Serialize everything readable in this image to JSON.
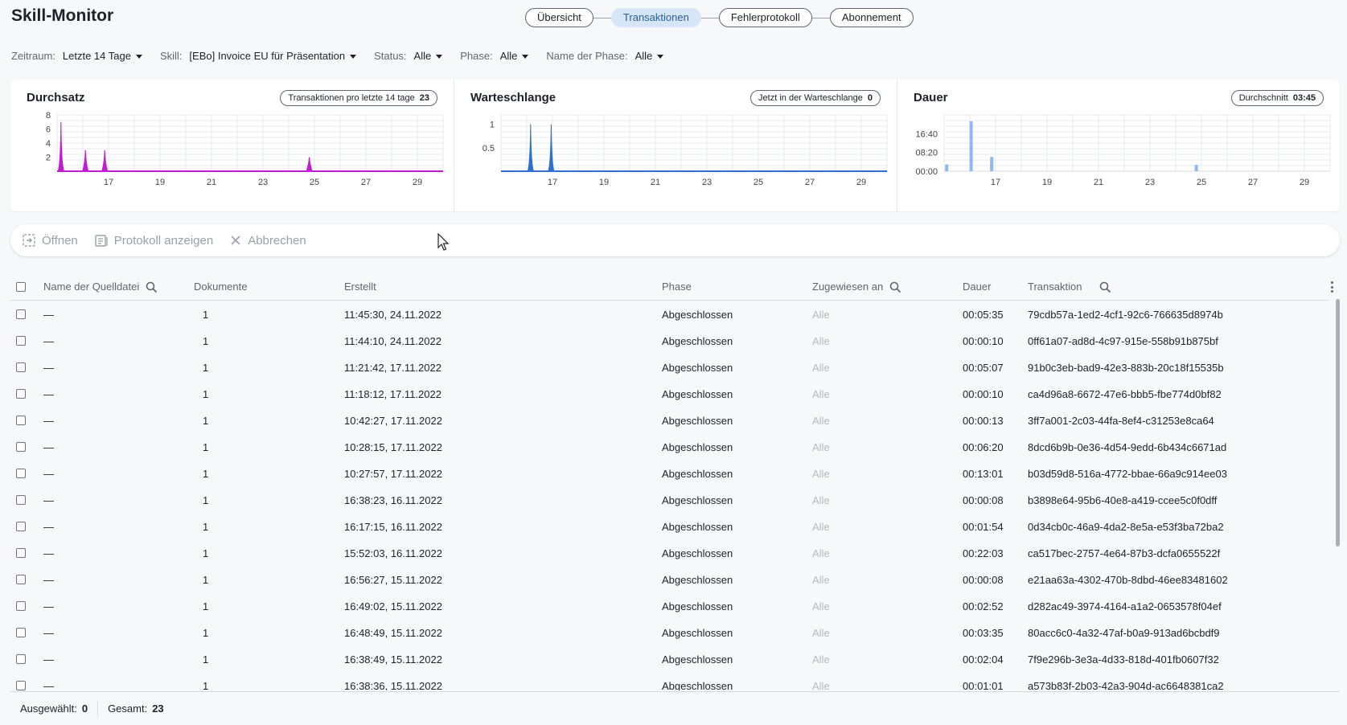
{
  "app": {
    "title": "Skill-Monitor"
  },
  "tabs": [
    {
      "label": "Übersicht",
      "active": false
    },
    {
      "label": "Transaktionen",
      "active": true
    },
    {
      "label": "Fehlerprotokoll",
      "active": false
    },
    {
      "label": "Abonnement",
      "active": false
    }
  ],
  "filters": {
    "period": {
      "label": "Zeitraum:",
      "value": "Letzte 14 Tage"
    },
    "skill": {
      "label": "Skill:",
      "value": "[EBo] Invoice EU für Präsentation"
    },
    "status": {
      "label": "Status:",
      "value": "Alle"
    },
    "phase": {
      "label": "Phase:",
      "value": "Alle"
    },
    "phase_name": {
      "label": "Name der Phase:",
      "value": "Alle"
    }
  },
  "cards": {
    "throughput": {
      "title": "Durchsatz",
      "badge_label": "Transaktionen pro letzte 14 tage",
      "badge_value": "23"
    },
    "queue": {
      "title": "Warteschlange",
      "badge_label": "Jetzt in der Warteschlange",
      "badge_value": "0"
    },
    "duration": {
      "title": "Dauer",
      "badge_label": "Durchschnitt",
      "badge_value": "03:45"
    }
  },
  "chart_data": [
    {
      "type": "area",
      "title": "Durchsatz",
      "x_ticks": [
        "17",
        "19",
        "21",
        "23",
        "25",
        "27",
        "29"
      ],
      "y_ticks": [
        "2",
        "4",
        "6",
        "8"
      ],
      "ylim": [
        0,
        8
      ],
      "xlim": [
        15,
        30
      ],
      "color": "#c21bd1",
      "grid": true,
      "points": [
        {
          "x": 15.15,
          "y": 7
        },
        {
          "x": 16.1,
          "y": 3
        },
        {
          "x": 16.85,
          "y": 3
        },
        {
          "x": 24.8,
          "y": 2
        }
      ]
    },
    {
      "type": "area",
      "title": "Warteschlange",
      "x_ticks": [
        "17",
        "19",
        "21",
        "23",
        "25",
        "27",
        "29"
      ],
      "y_ticks": [
        "0.5",
        "1"
      ],
      "ylim": [
        0,
        1.2
      ],
      "xlim": [
        15,
        30
      ],
      "color": "#2e6fcf",
      "grid": true,
      "points": [
        {
          "x": 16.15,
          "y": 1
        },
        {
          "x": 16.95,
          "y": 1
        }
      ]
    },
    {
      "type": "bar",
      "title": "Dauer",
      "x_ticks": [
        "17",
        "19",
        "21",
        "23",
        "25",
        "27",
        "29"
      ],
      "y_ticks": [
        "00:00",
        "08:20",
        "16:40"
      ],
      "ylim": [
        0,
        1500
      ],
      "xlim": [
        15,
        30
      ],
      "color": "#8fb8ec",
      "grid": true,
      "points": [
        {
          "x": 15.1,
          "y": 180
        },
        {
          "x": 16.05,
          "y": 1330
        },
        {
          "x": 16.85,
          "y": 380
        },
        {
          "x": 24.8,
          "y": 170
        }
      ]
    }
  ],
  "toolbar": {
    "open": "Öffnen",
    "show_log": "Protokoll anzeigen",
    "cancel": "Abbrechen"
  },
  "table": {
    "columns": {
      "source": "Name der Quelldatei",
      "documents": "Dokumente",
      "created": "Erstellt",
      "phase": "Phase",
      "assigned": "Zugewiesen an",
      "duration": "Dauer",
      "transaction": "Transaktion"
    },
    "rows": [
      {
        "source": "—",
        "documents": "1",
        "created": "11:45:30, 24.11.2022",
        "phase": "Abgeschlossen",
        "assigned": "Alle",
        "duration": "00:05:35",
        "transaction": "79cdb57a-1ed2-4cf1-92c6-766635d8974b"
      },
      {
        "source": "—",
        "documents": "1",
        "created": "11:44:10, 24.11.2022",
        "phase": "Abgeschlossen",
        "assigned": "Alle",
        "duration": "00:00:10",
        "transaction": "0ff61a07-ad8d-4c97-915e-558b91b875bf"
      },
      {
        "source": "—",
        "documents": "1",
        "created": "11:21:42, 17.11.2022",
        "phase": "Abgeschlossen",
        "assigned": "Alle",
        "duration": "00:05:07",
        "transaction": "91b0c3eb-bad9-42e3-883b-20c18f15535b"
      },
      {
        "source": "—",
        "documents": "1",
        "created": "11:18:12, 17.11.2022",
        "phase": "Abgeschlossen",
        "assigned": "Alle",
        "duration": "00:00:10",
        "transaction": "ca4d96a8-6672-47e6-bbb5-fbe774d0bf82"
      },
      {
        "source": "—",
        "documents": "1",
        "created": "10:42:27, 17.11.2022",
        "phase": "Abgeschlossen",
        "assigned": "Alle",
        "duration": "00:00:13",
        "transaction": "3ff7a001-2c03-44fa-8ef4-c31253e8ca64"
      },
      {
        "source": "—",
        "documents": "1",
        "created": "10:28:15, 17.11.2022",
        "phase": "Abgeschlossen",
        "assigned": "Alle",
        "duration": "00:06:20",
        "transaction": "8dcd6b9b-0e36-4d54-9edd-6b434c6671ad"
      },
      {
        "source": "—",
        "documents": "1",
        "created": "10:27:57, 17.11.2022",
        "phase": "Abgeschlossen",
        "assigned": "Alle",
        "duration": "00:13:01",
        "transaction": "b03d59d8-516a-4772-bbae-66a9c914ee03"
      },
      {
        "source": "—",
        "documents": "1",
        "created": "16:38:23, 16.11.2022",
        "phase": "Abgeschlossen",
        "assigned": "Alle",
        "duration": "00:00:08",
        "transaction": "b3898e64-95b6-40e8-a419-ccee5c0f0dff"
      },
      {
        "source": "—",
        "documents": "1",
        "created": "16:17:15, 16.11.2022",
        "phase": "Abgeschlossen",
        "assigned": "Alle",
        "duration": "00:01:54",
        "transaction": "0d34cb0c-46a9-4da2-8e5a-e53f3ba72ba2"
      },
      {
        "source": "—",
        "documents": "1",
        "created": "15:52:03, 16.11.2022",
        "phase": "Abgeschlossen",
        "assigned": "Alle",
        "duration": "00:22:03",
        "transaction": "ca517bec-2757-4e64-87b3-dcfa0655522f"
      },
      {
        "source": "—",
        "documents": "1",
        "created": "16:56:27, 15.11.2022",
        "phase": "Abgeschlossen",
        "assigned": "Alle",
        "duration": "00:00:08",
        "transaction": "e21aa63a-4302-470b-8dbd-46ee83481602"
      },
      {
        "source": "—",
        "documents": "1",
        "created": "16:49:02, 15.11.2022",
        "phase": "Abgeschlossen",
        "assigned": "Alle",
        "duration": "00:02:52",
        "transaction": "d282ac49-3974-4164-a1a2-0653578f04ef"
      },
      {
        "source": "—",
        "documents": "1",
        "created": "16:48:49, 15.11.2022",
        "phase": "Abgeschlossen",
        "assigned": "Alle",
        "duration": "00:03:35",
        "transaction": "80acc6c0-4a32-47af-b0a9-913ad6bcbdf9"
      },
      {
        "source": "—",
        "documents": "1",
        "created": "16:38:49, 15.11.2022",
        "phase": "Abgeschlossen",
        "assigned": "Alle",
        "duration": "00:02:04",
        "transaction": "7f9e296b-3e3a-4d33-818d-401fb0607f32"
      },
      {
        "source": "—",
        "documents": "1",
        "created": "16:38:36, 15.11.2022",
        "phase": "Abgeschlossen",
        "assigned": "Alle",
        "duration": "00:01:01",
        "transaction": "a573b83f-2b03-42a3-904d-ac6648381ca2"
      }
    ]
  },
  "footer": {
    "selected_label": "Ausgewählt:",
    "selected_value": "0",
    "total_label": "Gesamt:",
    "total_value": "23"
  },
  "icons": {
    "search": "search-icon",
    "open": "open-icon",
    "log": "log-icon",
    "cancel": "close-icon",
    "more": "more-vertical-icon",
    "caret": "chevron-down-icon"
  }
}
